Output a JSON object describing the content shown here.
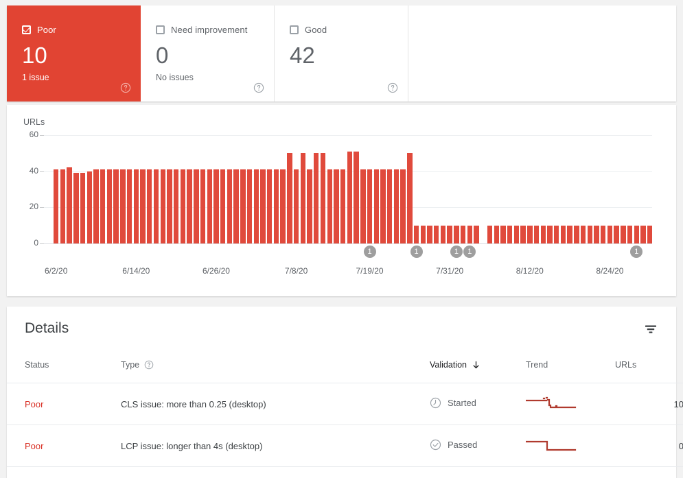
{
  "theme": {
    "accent_red": "#e14433",
    "bar_red": "#e04a3c",
    "status_red": "#d93025",
    "gray_text": "#5f6368",
    "page_bg": "#f2f2f2"
  },
  "summary": {
    "cards": [
      {
        "id": "poor",
        "label": "Poor",
        "value": "10",
        "sub": "1 issue",
        "checked": true,
        "selected": true,
        "help_icon": "help-circle-icon"
      },
      {
        "id": "need-improvement",
        "label": "Need improvement",
        "value": "0",
        "sub": "No issues",
        "checked": false,
        "selected": false,
        "help_icon": "help-circle-icon"
      },
      {
        "id": "good",
        "label": "Good",
        "value": "42",
        "sub": "",
        "checked": false,
        "selected": false,
        "help_icon": "help-circle-icon"
      }
    ]
  },
  "chart_data": {
    "type": "bar",
    "title": "",
    "ylabel": "URLs",
    "xlabel": "",
    "ylim": [
      0,
      60
    ],
    "yticks": [
      0,
      20,
      40,
      60
    ],
    "grid": true,
    "legend": "none",
    "bar_color": "#e04a3c",
    "xtick_labels": [
      "6/2/20",
      "6/14/20",
      "6/26/20",
      "7/8/20",
      "7/19/20",
      "7/31/20",
      "8/12/20",
      "8/24/20"
    ],
    "xtick_indices": [
      0,
      12,
      24,
      36,
      47,
      59,
      71,
      83
    ],
    "categories": [
      "6/2/20",
      "6/3/20",
      "6/4/20",
      "6/5/20",
      "6/6/20",
      "6/7/20",
      "6/8/20",
      "6/9/20",
      "6/10/20",
      "6/11/20",
      "6/12/20",
      "6/13/20",
      "6/14/20",
      "6/15/20",
      "6/16/20",
      "6/17/20",
      "6/18/20",
      "6/19/20",
      "6/20/20",
      "6/21/20",
      "6/22/20",
      "6/23/20",
      "6/24/20",
      "6/25/20",
      "6/26/20",
      "6/27/20",
      "6/28/20",
      "6/29/20",
      "6/30/20",
      "7/1/20",
      "7/2/20",
      "7/3/20",
      "7/4/20",
      "7/5/20",
      "7/6/20",
      "7/7/20",
      "7/8/20",
      "7/9/20",
      "7/10/20",
      "7/11/20",
      "7/12/20",
      "7/13/20",
      "7/14/20",
      "7/15/20",
      "7/16/20",
      "7/17/20",
      "7/18/20",
      "7/19/20",
      "7/20/20",
      "7/21/20",
      "7/22/20",
      "7/23/20",
      "7/24/20",
      "7/25/20",
      "7/26/20",
      "7/27/20",
      "7/28/20",
      "7/29/20",
      "7/30/20",
      "7/31/20",
      "8/1/20",
      "8/2/20",
      "8/3/20",
      "8/4/20",
      "8/5/20",
      "8/6/20",
      "8/7/20",
      "8/8/20",
      "8/9/20",
      "8/10/20",
      "8/11/20",
      "8/12/20",
      "8/13/20",
      "8/14/20",
      "8/15/20",
      "8/16/20",
      "8/17/20",
      "8/18/20",
      "8/19/20",
      "8/20/20",
      "8/21/20",
      "8/22/20",
      "8/23/20",
      "8/24/20",
      "8/25/20",
      "8/26/20",
      "8/27/20",
      "8/28/20",
      "8/29/20",
      "8/30/20"
    ],
    "values": [
      41,
      41,
      42,
      39,
      39,
      40,
      41,
      41,
      41,
      41,
      41,
      41,
      41,
      41,
      41,
      41,
      41,
      41,
      41,
      41,
      41,
      41,
      41,
      41,
      41,
      41,
      41,
      41,
      41,
      41,
      41,
      41,
      41,
      41,
      41,
      50,
      41,
      50,
      41,
      50,
      50,
      41,
      41,
      41,
      51,
      51,
      41,
      41,
      41,
      41,
      41,
      41,
      41,
      50,
      10,
      10,
      10,
      10,
      10,
      10,
      10,
      10,
      10,
      10,
      0,
      10,
      10,
      10,
      10,
      10,
      10,
      10,
      10,
      10,
      10,
      10,
      10,
      10,
      10,
      10,
      10,
      10,
      10,
      10,
      10,
      10,
      10,
      10,
      10,
      10
    ],
    "annotations": [
      {
        "label": "1",
        "x_index": 47
      },
      {
        "label": "1",
        "x_index": 54
      },
      {
        "label": "1",
        "x_index": 60
      },
      {
        "label": "1",
        "x_index": 62
      },
      {
        "label": "1",
        "x_index": 87
      }
    ]
  },
  "details": {
    "title": "Details",
    "filter_icon": "filter-icon",
    "columns": [
      {
        "key": "status",
        "label": "Status",
        "sorted": false
      },
      {
        "key": "type",
        "label": "Type",
        "sorted": false,
        "help_icon": "help-circle-icon"
      },
      {
        "key": "validation",
        "label": "Validation",
        "sorted": true,
        "sort_dir": "down"
      },
      {
        "key": "trend",
        "label": "Trend",
        "sorted": false
      },
      {
        "key": "urls",
        "label": "URLs",
        "sorted": false
      }
    ],
    "rows": [
      {
        "status": "Poor",
        "type": "CLS issue: more than 0.25 (desktop)",
        "validation": "Started",
        "validation_icon": "clock-icon",
        "trend_icon": "sparkline-declining",
        "urls": "10"
      },
      {
        "status": "Poor",
        "type": "LCP issue: longer than 4s (desktop)",
        "validation": "Passed",
        "validation_icon": "check-circle-icon",
        "trend_icon": "sparkline-step-down",
        "urls": "0"
      }
    ]
  }
}
